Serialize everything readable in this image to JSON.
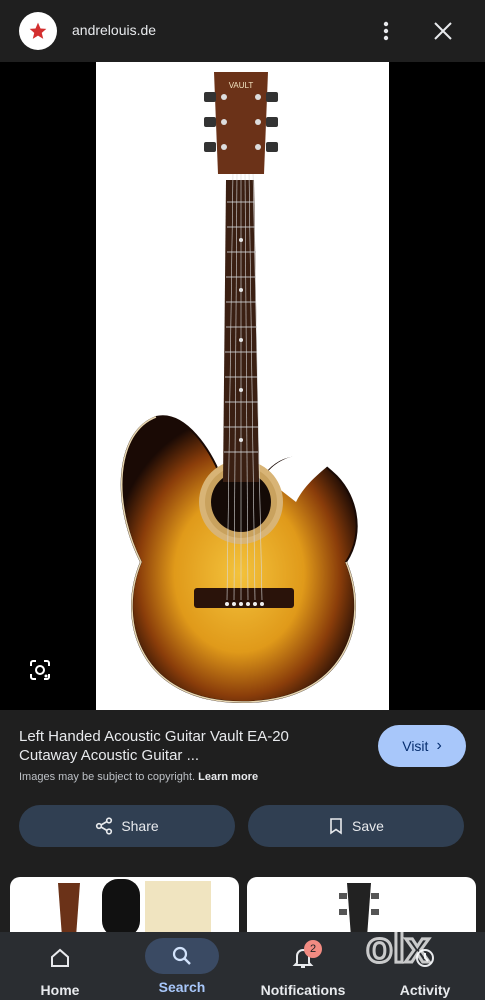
{
  "header": {
    "site": "andrelouis.de",
    "logo_icon": "red-star-icon"
  },
  "image": {
    "subject": "acoustic-guitar-sunburst",
    "headstock_logo": "VAULT"
  },
  "result": {
    "title": "Left Handed Acoustic Guitar Vault EA-20 Cutaway Acoustic Guitar ...",
    "copyright": "Images may be subject to copyright.",
    "learn_more": "Learn more",
    "visit_label": "Visit"
  },
  "actions": {
    "share_label": "Share",
    "save_label": "Save"
  },
  "nav": {
    "items": [
      {
        "label": "Home",
        "icon": "home-icon"
      },
      {
        "label": "Search",
        "icon": "search-icon",
        "active": true
      },
      {
        "label": "Notifications",
        "icon": "bell-icon",
        "badge": "2"
      },
      {
        "label": "Activity",
        "icon": "activity-icon"
      }
    ]
  },
  "watermark": "olx",
  "colors": {
    "background": "#1f1f1f",
    "accent": "#a8c7fa",
    "pill": "#303f52",
    "badge": "#f28b82"
  }
}
